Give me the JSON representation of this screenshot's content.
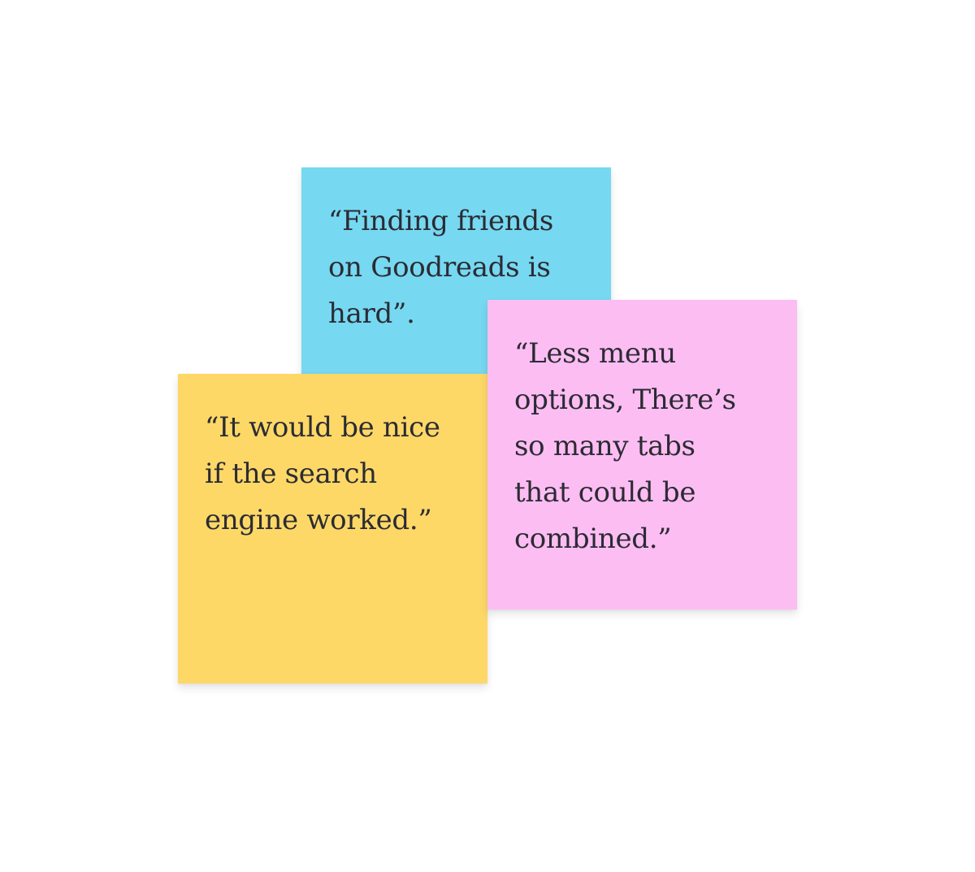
{
  "notes": {
    "blue": {
      "color": "#76d8f1",
      "lines": [
        "“Finding friends",
        "on Goodreads is",
        "hard”."
      ]
    },
    "yellow": {
      "color": "#fdd867",
      "lines": [
        "“It would be nice",
        "if the search",
        "engine worked.”"
      ]
    },
    "pink": {
      "color": "#fcbdf3",
      "lines": [
        "“Less menu",
        "options, There’s",
        "so many tabs",
        "that could be",
        "combined.”"
      ]
    }
  }
}
